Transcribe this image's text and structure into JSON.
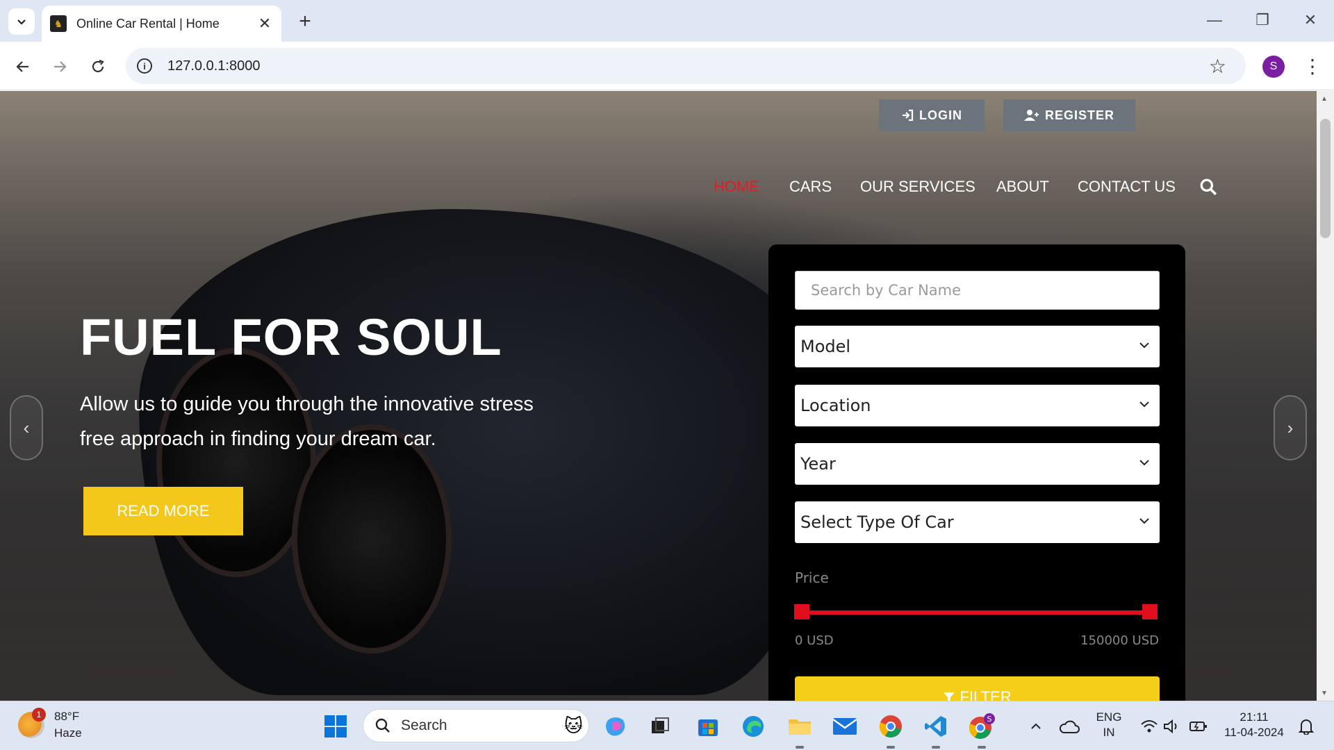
{
  "browser": {
    "tab_title": "Online Car Rental | Home",
    "url": "127.0.0.1:8000",
    "profile_initial": "S"
  },
  "header": {
    "login_label": "LOGIN",
    "register_label": "REGISTER",
    "nav": [
      {
        "label": "HOME",
        "active": true
      },
      {
        "label": "CARS",
        "active": false
      },
      {
        "label": "OUR SERVICES",
        "active": false
      },
      {
        "label": "ABOUT",
        "active": false
      },
      {
        "label": "CONTACT US",
        "active": false
      }
    ]
  },
  "hero": {
    "title": "FUEL FOR SOUL",
    "subtitle": "Allow us to guide you through the innovative stress free approach in finding your dream car.",
    "cta_label": "READ MORE"
  },
  "filter": {
    "search_placeholder": "Search by Car Name",
    "model_label": "Model",
    "location_label": "Location",
    "year_label": "Year",
    "type_label": "Select Type Of Car",
    "price_label": "Price",
    "price_min": "0 USD",
    "price_max": "150000 USD",
    "button_label": "FILTER"
  },
  "colors": {
    "accent_red": "#e01d25",
    "accent_yellow": "#f4c71b",
    "auth_button": "#6b737c"
  },
  "taskbar": {
    "weather_temp": "88°F",
    "weather_desc": "Haze",
    "weather_badge": "1",
    "search_label": "Search",
    "lang_line1": "ENG",
    "lang_line2": "IN",
    "time": "21:11",
    "date": "11-04-2024"
  }
}
